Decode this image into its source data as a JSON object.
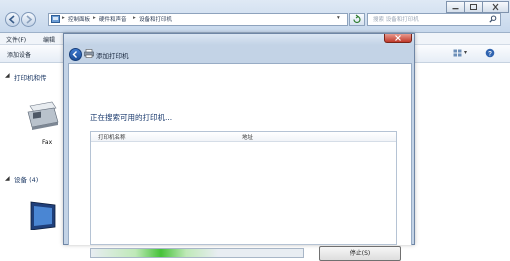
{
  "explorer": {
    "breadcrumb": [
      "控制面板",
      "硬件和声音",
      "设备和打印机"
    ],
    "search_placeholder": "搜索 设备和打印机",
    "menu": [
      "文件(F)",
      "编辑"
    ],
    "toolbar": {
      "add_device": "添加设备"
    },
    "groups": [
      {
        "label": "打印机和传",
        "expanded": true
      },
      {
        "label": "设备 (4)",
        "expanded": true
      }
    ],
    "devices": [
      {
        "name": "Fax",
        "icon": "fax-printer-icon"
      }
    ]
  },
  "dialog": {
    "title": "添加打印机",
    "searching_text": "正在搜索可用的打印机...",
    "columns": [
      "打印机名称",
      "地址"
    ],
    "progress_fraction": 0.6,
    "stop_button": "停止(S)"
  },
  "colors": {
    "accent": "#46c23a",
    "close_red": "#d9534f"
  }
}
